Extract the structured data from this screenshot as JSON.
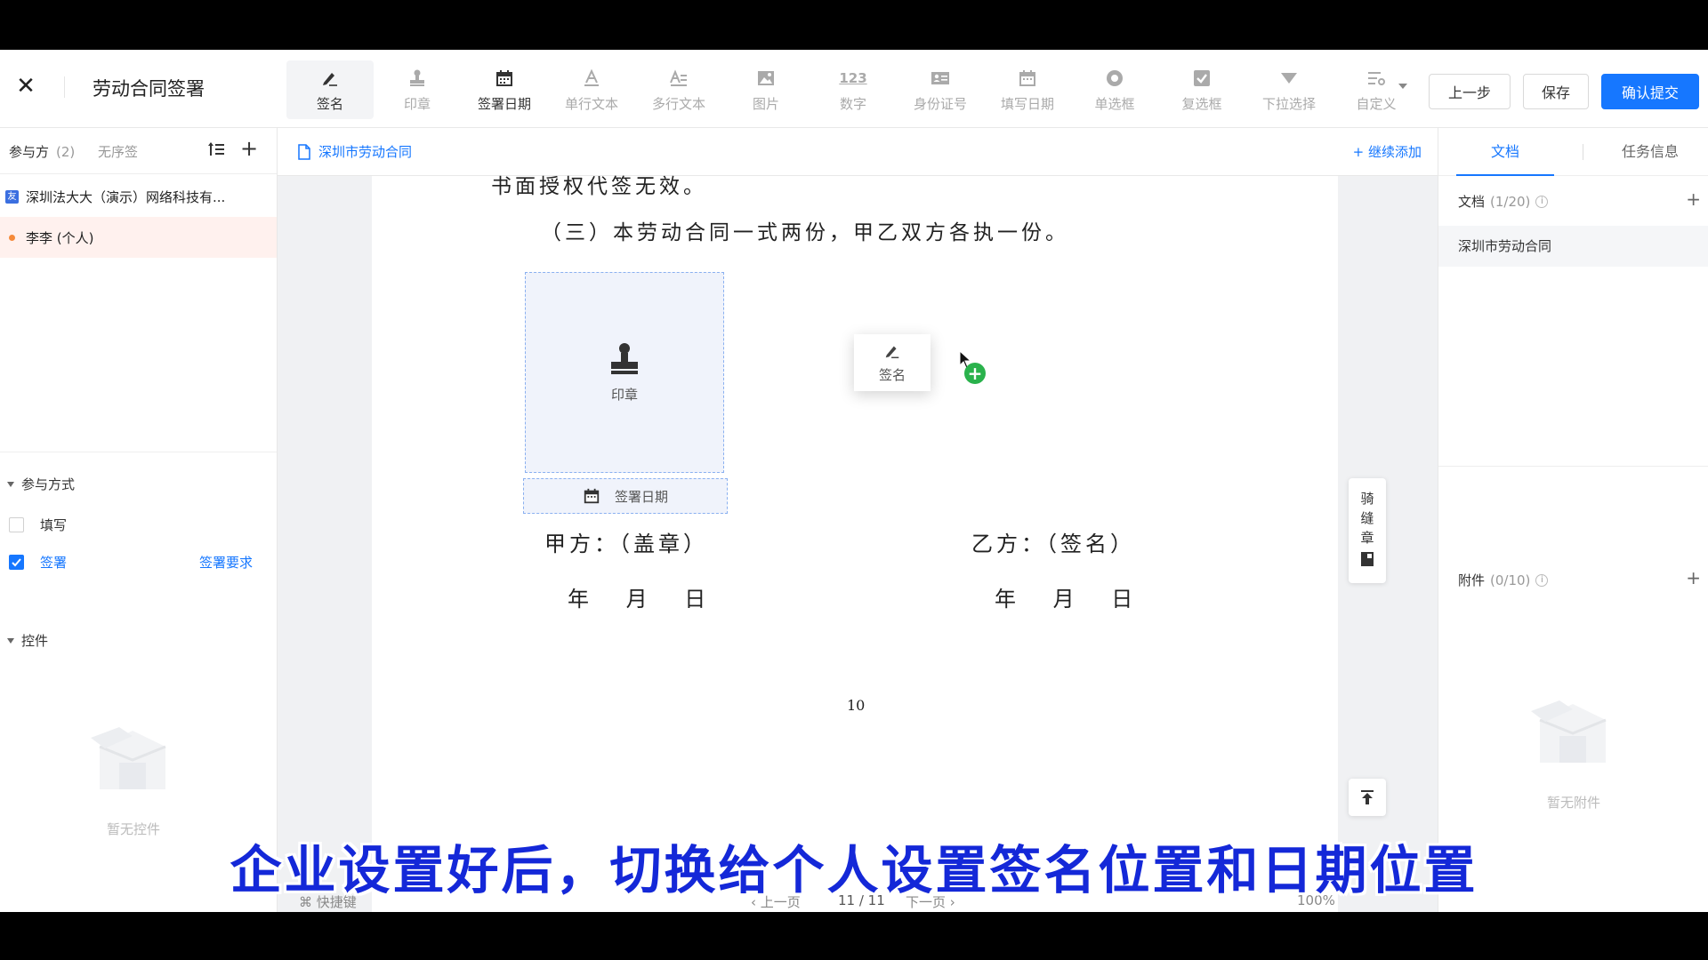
{
  "header": {
    "title": "劳动合同签署",
    "tools": [
      {
        "name": "sign",
        "label": "签名",
        "icon": "pen-icon"
      },
      {
        "name": "seal",
        "label": "印章",
        "icon": "stamp-icon"
      },
      {
        "name": "sign-date",
        "label": "签署日期",
        "icon": "calendar-icon"
      },
      {
        "name": "single-text",
        "label": "单行文本",
        "icon": "text-icon"
      },
      {
        "name": "multi-text",
        "label": "多行文本",
        "icon": "multiline-text-icon"
      },
      {
        "name": "image",
        "label": "图片",
        "icon": "image-icon"
      },
      {
        "name": "number",
        "label": "数字",
        "icon": "number-icon"
      },
      {
        "name": "id-number",
        "label": "身份证号",
        "icon": "id-card-icon"
      },
      {
        "name": "fill-date",
        "label": "填写日期",
        "icon": "calendar-icon"
      },
      {
        "name": "radio",
        "label": "单选框",
        "icon": "radio-icon"
      },
      {
        "name": "checkbox",
        "label": "复选框",
        "icon": "checkbox-icon"
      },
      {
        "name": "dropdown",
        "label": "下拉选择",
        "icon": "dropdown-icon"
      },
      {
        "name": "custom",
        "label": "自定义",
        "icon": "custom-icon"
      }
    ],
    "prev_label": "上一步",
    "save_label": "保存",
    "submit_label": "确认提交"
  },
  "left": {
    "participants_label": "参与方",
    "participants_count": "(2)",
    "no_order_label": "无序签",
    "parties": [
      {
        "badge": "友",
        "name": "深圳法大大（演示）网络科技有..."
      },
      {
        "name": "李李 (个人)"
      }
    ],
    "mode_title": "参与方式",
    "mode_fill": "填写",
    "mode_sign": "签署",
    "sign_req": "签署要求",
    "controls_title": "控件",
    "no_controls": "暂无控件"
  },
  "center": {
    "doc_tab": "深圳市劳动合同",
    "add_more": "+ 继续添加",
    "line1": "书面授权代签无效。",
    "line2": "（三）本劳动合同一式两份，甲乙双方各执一份。",
    "seal_label": "印章",
    "date_label": "签署日期",
    "sign_label": "签名",
    "party_a": "甲方：（盖章）",
    "party_b": "乙方：（签名）",
    "ymd": "年 月 日",
    "page_number": "10",
    "riding_seal": [
      "骑",
      "缝",
      "章"
    ],
    "footer": {
      "shortcut": "⌘ 快捷键",
      "prev": "‹ 上一页",
      "page": "11 / 11",
      "next": "下一页 ›",
      "zoom": "100%"
    }
  },
  "right": {
    "tab_doc": "文档",
    "tab_task": "任务信息",
    "docs_label": "文档",
    "docs_count": "(1/20)",
    "doc_item": "深圳市劳动合同",
    "attach_label": "附件",
    "attach_count": "(0/10)",
    "no_attach": "暂无附件"
  },
  "subtitle": "企业设置好后，切换给个人设置签名位置和日期位置",
  "colors": {
    "accent": "#1677ff",
    "subtitle": "#1428d8",
    "selected_row": "#fff1ee",
    "plus_green": "#2ab24c"
  }
}
